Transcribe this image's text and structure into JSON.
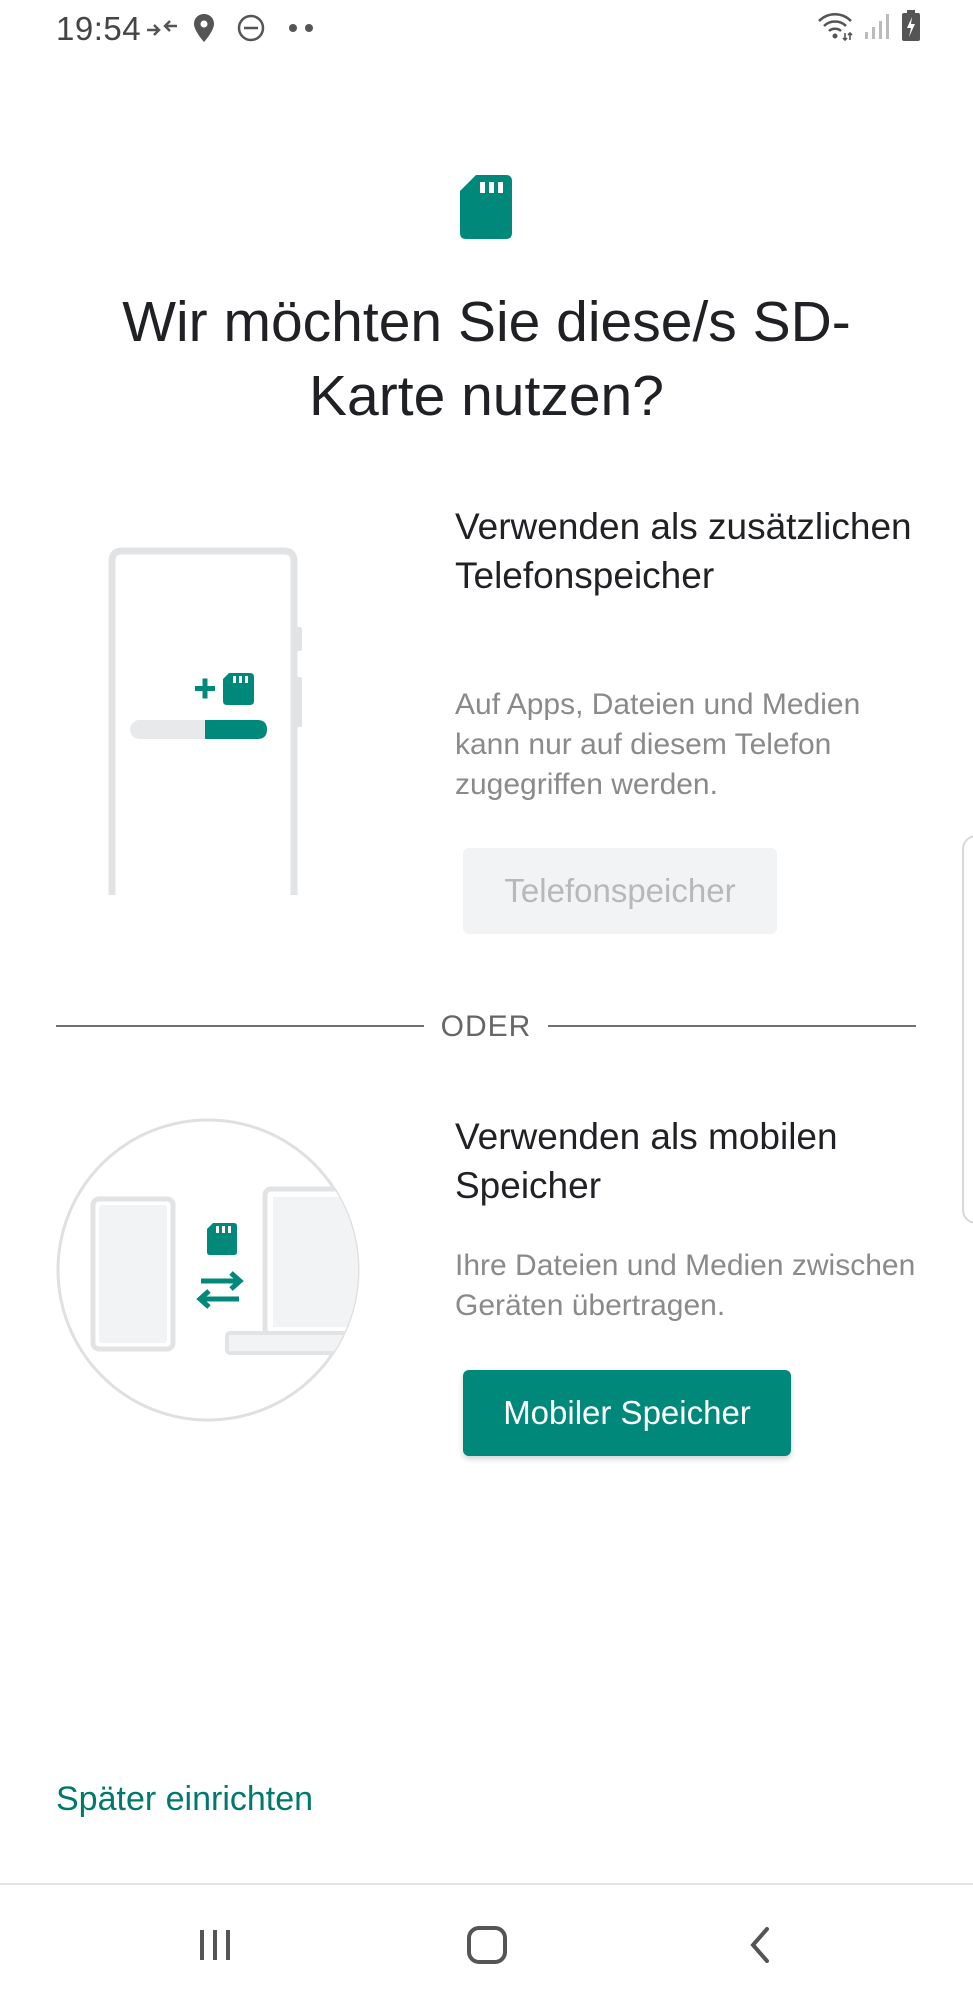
{
  "status_bar": {
    "time": "19:54",
    "left_icons": [
      "data-arrows-icon",
      "location-icon",
      "do-not-disturb-icon",
      "more-dots-icon"
    ],
    "right_icons": [
      "wifi-icon",
      "signal-icon",
      "battery-charging-icon"
    ]
  },
  "header": {
    "icon": "sd-card-icon",
    "title": "Wir möchten Sie diese/s SD-Karte nutzen?"
  },
  "option_internal": {
    "title": "Verwenden als zusätzlichen Telefonspeicher",
    "description": "Auf Apps, Dateien und Medien kann nur auf diesem Telefon zugegriffen werden.",
    "button_label": "Telefonspeicher",
    "button_enabled": false,
    "illustration": "phone-with-sd-card-storage-bar"
  },
  "divider": {
    "label": "ODER"
  },
  "option_portable": {
    "title": "Verwenden als mobilen Speicher",
    "description": "Ihre Dateien und Medien zwischen Geräten übertragen.",
    "button_label": "Mobiler Speicher",
    "button_enabled": true,
    "illustration": "phone-laptop-transfer"
  },
  "footer": {
    "later_label": "Später einrichten"
  },
  "nav_bar": {
    "buttons": [
      "recents-icon",
      "home-icon",
      "back-icon"
    ]
  },
  "colors": {
    "accent": "#00897b",
    "link": "#00796b",
    "disabled_bg": "#f1f3f4",
    "disabled_text": "#b6b8ba",
    "secondary_text": "#8a8a8a"
  }
}
